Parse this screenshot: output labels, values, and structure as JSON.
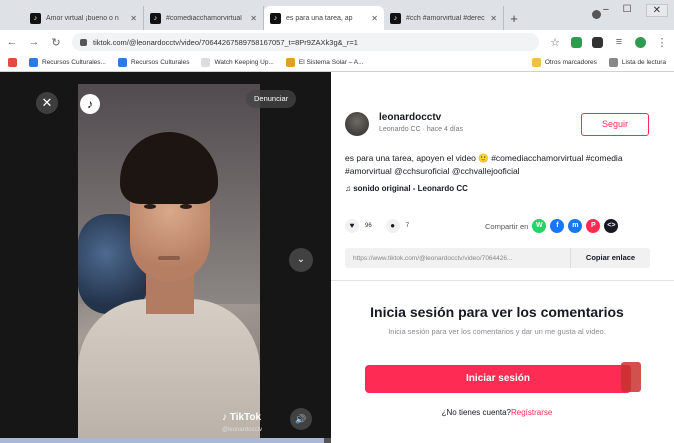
{
  "browser": {
    "tabs": [
      {
        "title": "Amor virtual ¡bueno o n",
        "active": false
      },
      {
        "title": "#comediacchamorvirtual",
        "active": false
      },
      {
        "title": "es para una tarea, ap",
        "active": true
      },
      {
        "title": "#cch #amorvirtual #derec",
        "active": false
      }
    ],
    "new_tab": "+",
    "url": "tiktok.com/@leonardocctv/video/70644267589758167057_t=8Pr9ZAXk3g&_r=1",
    "bookmarks": [
      {
        "label": "Recursos Culturales...",
        "color": "#2c7be5"
      },
      {
        "label": "Recursos Culturales",
        "color": "#2c7be5"
      },
      {
        "label": "Watch Keeping Up...",
        "color": "#dddddd"
      },
      {
        "label": "El Sistema Solar – A...",
        "color": "#e0a020"
      }
    ],
    "bookmarks_right": [
      "Otros marcadores",
      "Lista de lectura"
    ]
  },
  "video": {
    "report_label": "Denunciar",
    "watermark": "TikTok",
    "watermark_user": "@leonardocctv",
    "progress": 0.98
  },
  "info": {
    "username": "leonardocctv",
    "subline": "Leonardo CC · hace 4 días",
    "follow_label": "Seguir",
    "description": "es para una tarea, apoyen el video 🙂 #comediacchamorvirtual #comedia #amorvirtual @cchsuroficial @cchvallejooficial",
    "sound": "♫  sonido original - Leonardo CC",
    "likes": "96",
    "comments": "7",
    "share_label": "Compartir en",
    "share_icons": [
      {
        "name": "whatsapp",
        "color": "#25d366",
        "glyph": "W"
      },
      {
        "name": "facebook",
        "color": "#1877f2",
        "glyph": "f"
      },
      {
        "name": "messenger",
        "color": "#1877f2",
        "glyph": "m"
      },
      {
        "name": "pinterest",
        "color": "#fe2c55",
        "glyph": "P"
      },
      {
        "name": "embed",
        "color": "#161823",
        "glyph": "<>"
      }
    ],
    "link": "https://www.tiktok.com/@leonardocctv/video/7064426...",
    "copy_label": "Copiar enlace",
    "login_title": "Inicia sesión para ver los comentarios",
    "login_sub": "Inicia sesión para ver los comentarios y dar un me gusta al video.",
    "login_button": "Iniciar sesión",
    "signup_prompt": "¿No tienes cuenta?",
    "signup_link": "Regístrarse"
  }
}
